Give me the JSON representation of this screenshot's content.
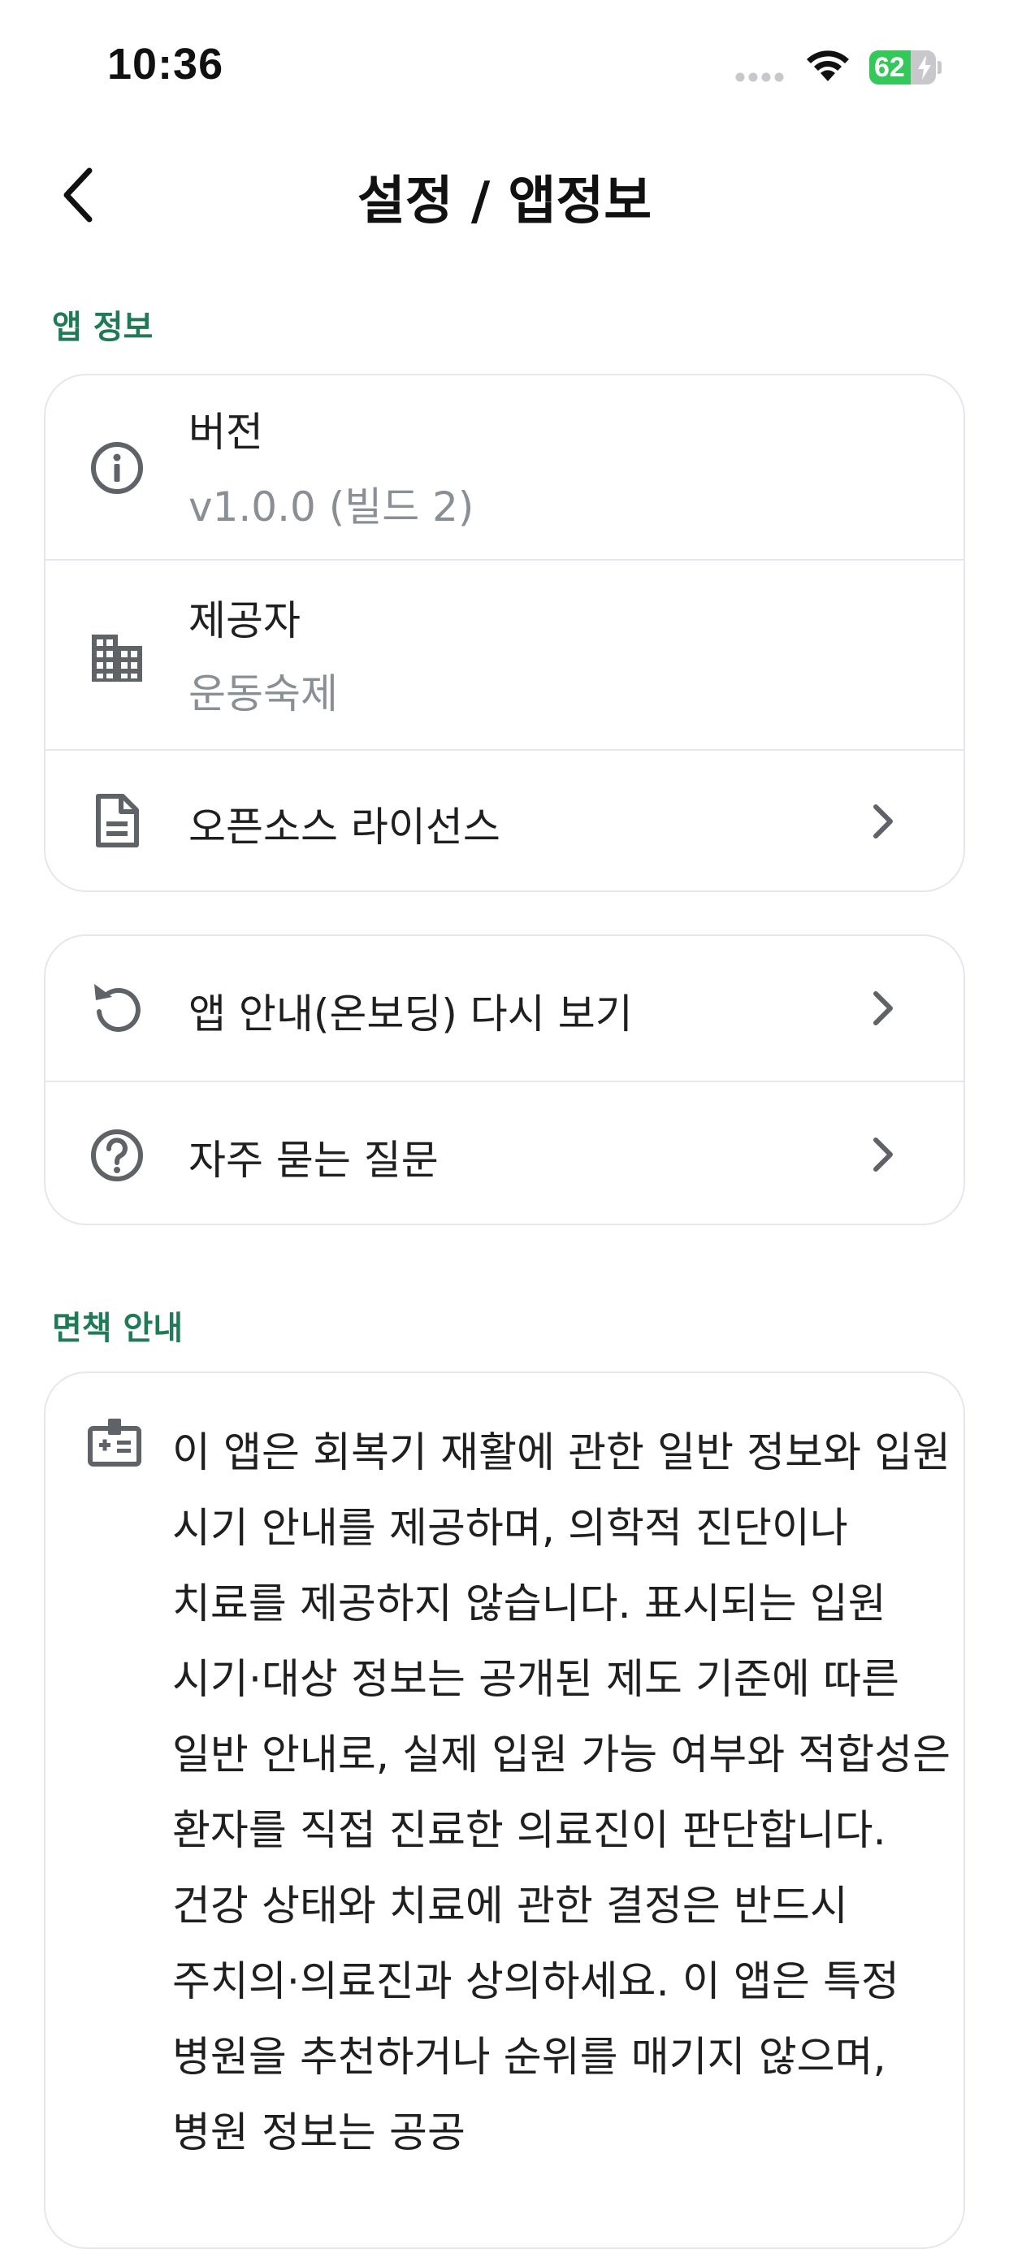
{
  "status_bar": {
    "time": "10:36",
    "battery_level": "62",
    "battery_percent": 62
  },
  "nav": {
    "title": "설정 / 앱정보"
  },
  "app_info_section": {
    "header": "앱 정보",
    "version": {
      "label": "버전",
      "value": "v1.0.0 (빌드 2)",
      "icon": "info-circle-icon"
    },
    "provider": {
      "label": "제공자",
      "value": "운동숙제",
      "icon": "building-icon"
    },
    "license": {
      "label": "오픈소스 라이선스",
      "icon": "document-icon"
    }
  },
  "help_section": {
    "onboarding": {
      "label": "앱 안내(온보딩) 다시 보기",
      "icon": "replay-icon"
    },
    "faq": {
      "label": "자주 묻는 질문",
      "icon": "question-circle-icon"
    }
  },
  "disclaimer_section": {
    "header": "면책 안내",
    "icon": "medical-badge-icon",
    "text": "이 앱은 회복기 재활에 관한 일반 정보와 입원 시기 안내를 제공하며, 의학적 진단이나 치료를 제공하지 않습니다. 표시되는 입원 시기·대상 정보는 공개된 제도 기준에 따른 일반 안내로, 실제 입원 가능 여부와 적합성은 환자를 직접 진료한 의료진이 판단합니다. 건강 상태와 치료에 관한 결정은 반드시 주치의·의료진과 상의하세요. 이 앱은 특정 병원을 추천하거나 순위를 매기지 않으며, 병원 정보는 공공"
  },
  "colors": {
    "accent": "#1f7a57",
    "border": "#e4e7ec",
    "secondary_text": "#8a8f95",
    "icon": "#5f6368"
  }
}
